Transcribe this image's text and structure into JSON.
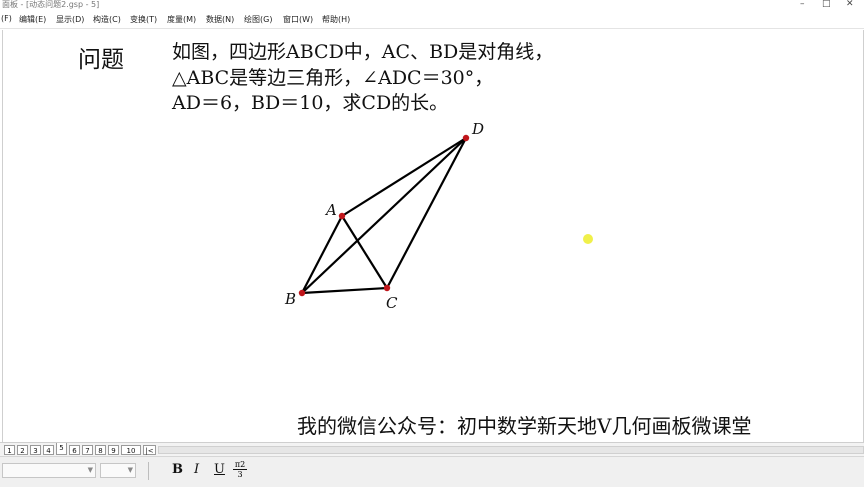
{
  "window": {
    "title_fragment": "面板 - [动态问题2.gsp - 5]",
    "controls": [
      "–",
      "□",
      "✕"
    ]
  },
  "menu": [
    "(F)",
    "编辑(E)",
    "显示(D)",
    "构造(C)",
    "变换(T)",
    "度量(M)",
    "数据(N)",
    "绘图(G)",
    "窗口(W)",
    "帮助(H)"
  ],
  "problem": {
    "label": "问题",
    "line1": "如图，四边形ABCD中，AC、BD是对角线，",
    "line2": "△ABC是等边三角形，∠ADC＝30°，",
    "line3": "AD＝6，BD＝10，求CD的长。"
  },
  "figure": {
    "points": {
      "A": "A",
      "B": "B",
      "C": "C",
      "D": "D"
    },
    "point_color": "#c0161b",
    "cursor_color": "#f0f04a"
  },
  "footer": {
    "wechat": "我的微信公众号：初中数学新天地V几何画板微课堂"
  },
  "pages": {
    "tabs": [
      "1",
      "2",
      "3",
      "4",
      "5",
      "6",
      "7",
      "8",
      "9",
      "10"
    ],
    "nav": "|<",
    "active": "5"
  },
  "format": {
    "bold": "B",
    "italic": "I",
    "underline": "U",
    "fraction_top": "π2",
    "fraction_bottom": "3"
  }
}
